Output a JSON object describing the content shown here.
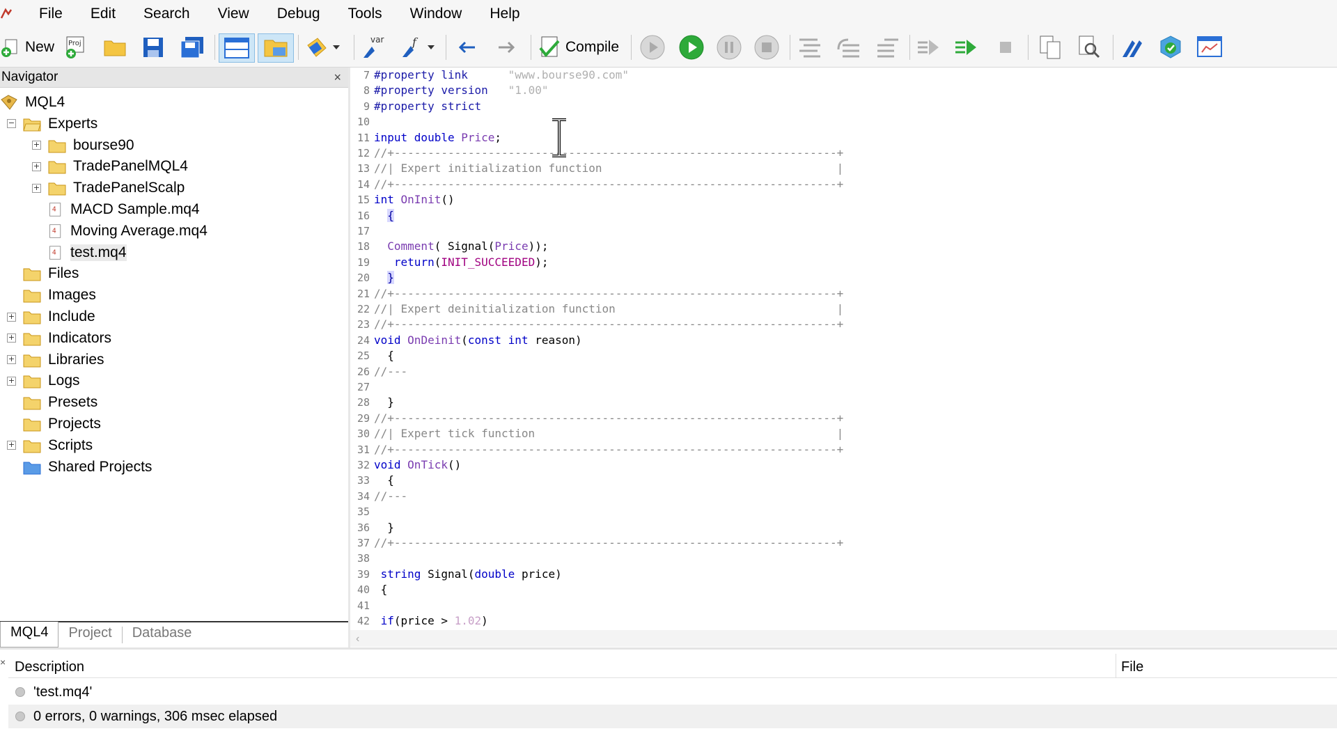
{
  "menu": {
    "items": [
      "File",
      "Edit",
      "Search",
      "View",
      "Debug",
      "Tools",
      "Window",
      "Help"
    ]
  },
  "toolbar": {
    "new_label": "New",
    "compile_label": "Compile",
    "var_label": "var",
    "proj_label": "Proj",
    "icons": [
      "new-icon",
      "new-project-icon",
      "open-icon",
      "save-icon",
      "save-all-icon",
      "navigator-toggle-icon",
      "toolbox-toggle-icon",
      "styler-icon",
      "variables-icon",
      "function-icon",
      "back-icon",
      "forward-icon",
      "compile-icon",
      "start-real-icon",
      "start-icon",
      "pause-icon",
      "stop-icon",
      "step-into-icon",
      "step-over-icon",
      "step-out-icon",
      "run-to-icon",
      "run-icon",
      "stop-debug-icon",
      "copy-icon",
      "search-icon",
      "mql5-icon",
      "storage-icon",
      "terminal-icon"
    ]
  },
  "navigator": {
    "title": "Navigator",
    "close": "×",
    "tree": [
      {
        "label": "MQL4",
        "type": "root",
        "level": 0,
        "expander": ""
      },
      {
        "label": "Experts",
        "type": "folder-open",
        "level": 1,
        "expander": "−"
      },
      {
        "label": "bourse90",
        "type": "folder",
        "level": 2,
        "expander": "+"
      },
      {
        "label": "TradePanelMQL4",
        "type": "folder",
        "level": 2,
        "expander": "+"
      },
      {
        "label": "TradePanelScalp",
        "type": "folder",
        "level": 2,
        "expander": "+"
      },
      {
        "label": "MACD Sample.mq4",
        "type": "file",
        "level": 2,
        "expander": ""
      },
      {
        "label": "Moving Average.mq4",
        "type": "file",
        "level": 2,
        "expander": ""
      },
      {
        "label": "test.mq4",
        "type": "file",
        "level": 2,
        "expander": "",
        "selected": true
      },
      {
        "label": "Files",
        "type": "folder",
        "level": 1,
        "expander": ""
      },
      {
        "label": "Images",
        "type": "folder",
        "level": 1,
        "expander": ""
      },
      {
        "label": "Include",
        "type": "folder",
        "level": 1,
        "expander": "+"
      },
      {
        "label": "Indicators",
        "type": "folder",
        "level": 1,
        "expander": "+"
      },
      {
        "label": "Libraries",
        "type": "folder",
        "level": 1,
        "expander": "+"
      },
      {
        "label": "Logs",
        "type": "folder",
        "level": 1,
        "expander": "+"
      },
      {
        "label": "Presets",
        "type": "folder",
        "level": 1,
        "expander": ""
      },
      {
        "label": "Projects",
        "type": "folder",
        "level": 1,
        "expander": ""
      },
      {
        "label": "Scripts",
        "type": "folder",
        "level": 1,
        "expander": "+"
      },
      {
        "label": "Shared Projects",
        "type": "folder-blue",
        "level": 1,
        "expander": ""
      }
    ],
    "tabs": [
      "MQL4",
      "Project",
      "Database"
    ],
    "active_tab": "MQL4"
  },
  "editor": {
    "lines": [
      {
        "n": "7",
        "tokens": [
          [
            "pp",
            "#property link"
          ],
          [
            "pl",
            "      "
          ],
          [
            "str",
            "\"www.bourse90.com\""
          ]
        ]
      },
      {
        "n": "8",
        "tokens": [
          [
            "pp",
            "#property version"
          ],
          [
            "pl",
            "   "
          ],
          [
            "str",
            "\"1.00\""
          ]
        ]
      },
      {
        "n": "9",
        "tokens": [
          [
            "pp",
            "#property strict"
          ]
        ]
      },
      {
        "n": "10",
        "tokens": []
      },
      {
        "n": "11",
        "tokens": [
          [
            "kw",
            "input double "
          ],
          [
            "fn",
            "Price"
          ],
          [
            "pl",
            ";"
          ]
        ]
      },
      {
        "n": "12",
        "tokens": [
          [
            "cmt",
            "//+------------------------------------------------------------------+"
          ]
        ]
      },
      {
        "n": "13",
        "tokens": [
          [
            "cmt",
            "//| Expert initialization function                                   |"
          ]
        ]
      },
      {
        "n": "14",
        "tokens": [
          [
            "cmt",
            "//+------------------------------------------------------------------+"
          ]
        ]
      },
      {
        "n": "15",
        "tokens": [
          [
            "kw",
            "int "
          ],
          [
            "fn",
            "OnInit"
          ],
          [
            "pl",
            "()"
          ]
        ]
      },
      {
        "n": "16",
        "tokens": [
          [
            "pl",
            "  "
          ],
          [
            "brace",
            "{"
          ]
        ]
      },
      {
        "n": "17",
        "tokens": []
      },
      {
        "n": "18",
        "tokens": [
          [
            "pl",
            "  "
          ],
          [
            "fn",
            "Comment"
          ],
          [
            "pl",
            "( Signal("
          ],
          [
            "fn",
            "Price"
          ],
          [
            "pl",
            "));"
          ]
        ]
      },
      {
        "n": "19",
        "tokens": [
          [
            "pl",
            "   "
          ],
          [
            "kw",
            "return"
          ],
          [
            "pl",
            "("
          ],
          [
            "cst",
            "INIT_SUCCEEDED"
          ],
          [
            "pl",
            ");"
          ]
        ]
      },
      {
        "n": "20",
        "tokens": [
          [
            "pl",
            "  "
          ],
          [
            "brace",
            "}"
          ]
        ]
      },
      {
        "n": "21",
        "tokens": [
          [
            "cmt",
            "//+------------------------------------------------------------------+"
          ]
        ]
      },
      {
        "n": "22",
        "tokens": [
          [
            "cmt",
            "//| Expert deinitialization function                                 |"
          ]
        ]
      },
      {
        "n": "23",
        "tokens": [
          [
            "cmt",
            "//+------------------------------------------------------------------+"
          ]
        ]
      },
      {
        "n": "24",
        "tokens": [
          [
            "kw",
            "void "
          ],
          [
            "fn",
            "OnDeinit"
          ],
          [
            "pl",
            "("
          ],
          [
            "kw",
            "const int "
          ],
          [
            "pl",
            "reason)"
          ]
        ]
      },
      {
        "n": "25",
        "tokens": [
          [
            "pl",
            "  {"
          ]
        ]
      },
      {
        "n": "26",
        "tokens": [
          [
            "cmt",
            "//---"
          ]
        ]
      },
      {
        "n": "27",
        "tokens": []
      },
      {
        "n": "28",
        "tokens": [
          [
            "pl",
            "  }"
          ]
        ]
      },
      {
        "n": "29",
        "tokens": [
          [
            "cmt",
            "//+------------------------------------------------------------------+"
          ]
        ]
      },
      {
        "n": "30",
        "tokens": [
          [
            "cmt",
            "//| Expert tick function                                             |"
          ]
        ]
      },
      {
        "n": "31",
        "tokens": [
          [
            "cmt",
            "//+------------------------------------------------------------------+"
          ]
        ]
      },
      {
        "n": "32",
        "tokens": [
          [
            "kw",
            "void "
          ],
          [
            "fn",
            "OnTick"
          ],
          [
            "pl",
            "()"
          ]
        ]
      },
      {
        "n": "33",
        "tokens": [
          [
            "pl",
            "  {"
          ]
        ]
      },
      {
        "n": "34",
        "tokens": [
          [
            "cmt",
            "//---"
          ]
        ]
      },
      {
        "n": "35",
        "tokens": []
      },
      {
        "n": "36",
        "tokens": [
          [
            "pl",
            "  }"
          ]
        ]
      },
      {
        "n": "37",
        "tokens": [
          [
            "cmt",
            "//+------------------------------------------------------------------+"
          ]
        ]
      },
      {
        "n": "38",
        "tokens": []
      },
      {
        "n": "39",
        "tokens": [
          [
            "pl",
            " "
          ],
          [
            "kw",
            "string "
          ],
          [
            "pl",
            "Signal("
          ],
          [
            "kw",
            "double "
          ],
          [
            "pl",
            "price)"
          ]
        ]
      },
      {
        "n": "40",
        "tokens": [
          [
            "pl",
            " {"
          ]
        ]
      },
      {
        "n": "41",
        "tokens": []
      },
      {
        "n": "42",
        "tokens": [
          [
            "pl",
            " "
          ],
          [
            "kw",
            "if"
          ],
          [
            "pl",
            "(price > "
          ],
          [
            "num",
            "1.02"
          ],
          [
            "pl",
            ")"
          ]
        ]
      }
    ]
  },
  "output": {
    "columns": [
      "Description",
      "File"
    ],
    "rows": [
      "'test.mq4'",
      "0 errors, 0 warnings, 306 msec elapsed"
    ],
    "side_marker": "×"
  },
  "colors": {
    "keyword": "#0000c8",
    "comment": "#888888",
    "string": "#b0b0b0",
    "function": "#7a3cb0",
    "constant": "#a00080"
  }
}
